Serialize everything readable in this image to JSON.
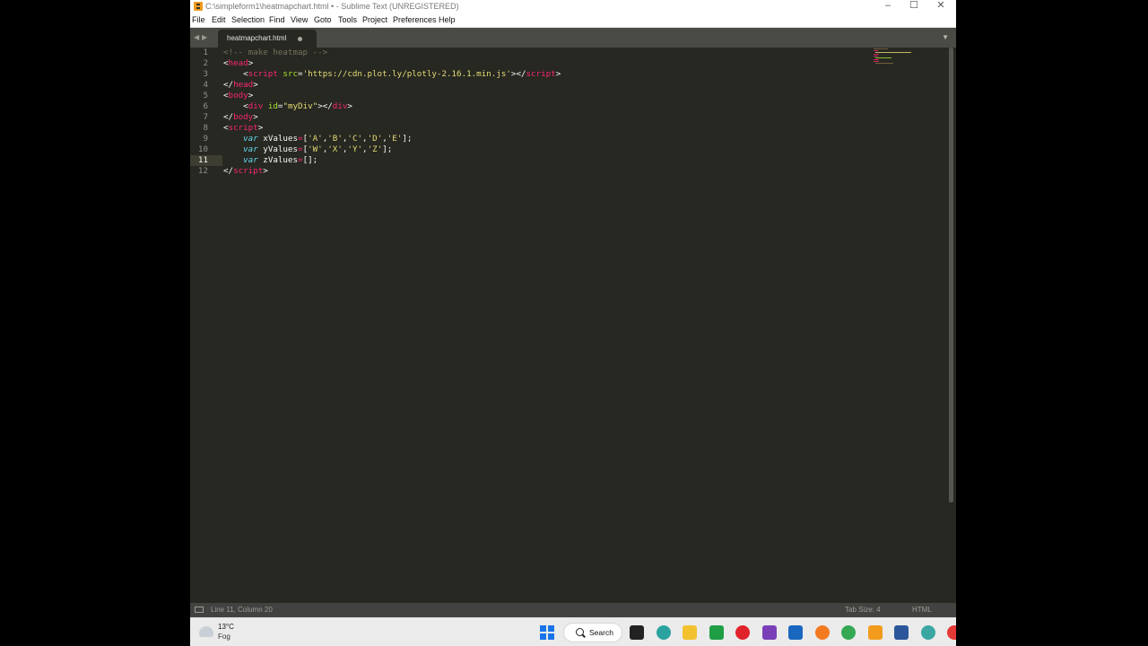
{
  "window": {
    "title": "C:\\simpleform1\\heatmapchart.html • - Sublime Text (UNREGISTERED)"
  },
  "menu": [
    "File",
    "Edit",
    "Selection",
    "Find",
    "View",
    "Goto",
    "Tools",
    "Project",
    "Preferences",
    "Help"
  ],
  "tabs": [
    {
      "label": "heatmapchart.html",
      "modified": true
    }
  ],
  "editor": {
    "current_line": 11,
    "line_numbers": [
      "1",
      "2",
      "3",
      "4",
      "5",
      "6",
      "7",
      "8",
      "9",
      "10",
      "11",
      "12"
    ],
    "lines": [
      [
        {
          "t": "<!-- make heatmap -->",
          "c": "comment"
        }
      ],
      [
        {
          "t": "<",
          "c": "plain"
        },
        {
          "t": "head",
          "c": "tag"
        },
        {
          "t": ">",
          "c": "plain"
        }
      ],
      [
        {
          "t": "    <",
          "c": "plain"
        },
        {
          "t": "script",
          "c": "tag"
        },
        {
          "t": " ",
          "c": "plain"
        },
        {
          "t": "src",
          "c": "attr"
        },
        {
          "t": "=",
          "c": "plain"
        },
        {
          "t": "'https://cdn.plot.ly/plotly-2.16.1.min.js'",
          "c": "string"
        },
        {
          "t": "></",
          "c": "plain"
        },
        {
          "t": "script",
          "c": "tag"
        },
        {
          "t": ">",
          "c": "plain"
        }
      ],
      [
        {
          "t": "</",
          "c": "plain"
        },
        {
          "t": "head",
          "c": "tag"
        },
        {
          "t": ">",
          "c": "plain"
        }
      ],
      [
        {
          "t": "<",
          "c": "plain"
        },
        {
          "t": "body",
          "c": "tag"
        },
        {
          "t": ">",
          "c": "plain"
        }
      ],
      [
        {
          "t": "    <",
          "c": "plain"
        },
        {
          "t": "div",
          "c": "tag"
        },
        {
          "t": " ",
          "c": "plain"
        },
        {
          "t": "id",
          "c": "attr"
        },
        {
          "t": "=",
          "c": "plain"
        },
        {
          "t": "\"myDiv\"",
          "c": "string"
        },
        {
          "t": "></",
          "c": "plain"
        },
        {
          "t": "div",
          "c": "tag"
        },
        {
          "t": ">",
          "c": "plain"
        }
      ],
      [
        {
          "t": "</",
          "c": "plain"
        },
        {
          "t": "body",
          "c": "tag"
        },
        {
          "t": ">",
          "c": "plain"
        }
      ],
      [
        {
          "t": "<",
          "c": "plain"
        },
        {
          "t": "script",
          "c": "tag"
        },
        {
          "t": ">",
          "c": "plain"
        }
      ],
      [
        {
          "t": "    ",
          "c": "plain"
        },
        {
          "t": "var",
          "c": "kw"
        },
        {
          "t": " xValues",
          "c": "plain"
        },
        {
          "t": "=",
          "c": "op"
        },
        {
          "t": "[",
          "c": "plain"
        },
        {
          "t": "'A'",
          "c": "string"
        },
        {
          "t": ",",
          "c": "plain"
        },
        {
          "t": "'B'",
          "c": "string"
        },
        {
          "t": ",",
          "c": "plain"
        },
        {
          "t": "'C'",
          "c": "string"
        },
        {
          "t": ",",
          "c": "plain"
        },
        {
          "t": "'D'",
          "c": "string"
        },
        {
          "t": ",",
          "c": "plain"
        },
        {
          "t": "'E'",
          "c": "string"
        },
        {
          "t": "];",
          "c": "plain"
        }
      ],
      [
        {
          "t": "    ",
          "c": "plain"
        },
        {
          "t": "var",
          "c": "kw"
        },
        {
          "t": " yValues",
          "c": "plain"
        },
        {
          "t": "=",
          "c": "op"
        },
        {
          "t": "[",
          "c": "plain"
        },
        {
          "t": "'W'",
          "c": "string"
        },
        {
          "t": ",",
          "c": "plain"
        },
        {
          "t": "'X'",
          "c": "string"
        },
        {
          "t": ",",
          "c": "plain"
        },
        {
          "t": "'Y'",
          "c": "string"
        },
        {
          "t": ",",
          "c": "plain"
        },
        {
          "t": "'Z'",
          "c": "string"
        },
        {
          "t": "];",
          "c": "plain"
        }
      ],
      [
        {
          "t": "    ",
          "c": "plain"
        },
        {
          "t": "var",
          "c": "kw"
        },
        {
          "t": " zValues",
          "c": "plain"
        },
        {
          "t": "=",
          "c": "op"
        },
        {
          "t": "[];",
          "c": "plain"
        }
      ],
      [
        {
          "t": "</",
          "c": "plain"
        },
        {
          "t": "script",
          "c": "tag"
        },
        {
          "t": ">",
          "c": "plain"
        }
      ]
    ]
  },
  "status": {
    "position": "Line 11, Column 20",
    "tab_size": "Tab Size: 4",
    "syntax": "HTML"
  },
  "taskbar": {
    "temperature": "13°C",
    "condition": "Fog",
    "search_label": "Search"
  },
  "colors": {
    "editor_bg": "#272822",
    "tag": "#f92672",
    "attr": "#a6e22e",
    "string": "#e6db74",
    "keyword": "#66d9ef",
    "comment": "#75715e"
  }
}
